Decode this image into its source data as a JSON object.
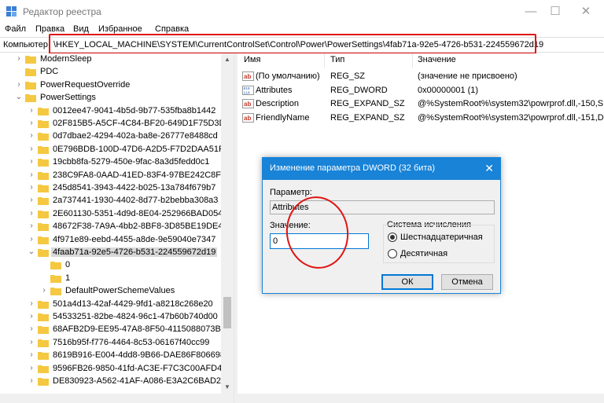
{
  "window": {
    "title": "Редактор реестра",
    "controls": {
      "minimize": "—",
      "maximize": "☐",
      "close": "✕"
    }
  },
  "menu": [
    "Файл",
    "Правка",
    "Вид",
    "Избранное",
    "Справка"
  ],
  "address": {
    "label": "Компьютер",
    "path": "\\HKEY_LOCAL_MACHINE\\SYSTEM\\CurrentControlSet\\Control\\Power\\PowerSettings\\4fab71a-92e5-4726-b531-224559672d19"
  },
  "tree": {
    "items": [
      {
        "label": "ModernSleep"
      },
      {
        "label": "PDC"
      },
      {
        "label": "PowerRequestOverride"
      },
      {
        "label": "PowerSettings"
      },
      {
        "label": "0012ee47-9041-4b5d-9b77-535fba8b1442"
      },
      {
        "label": "02F815B5-A5CF-4C84-BF20-649D1F75D3D8"
      },
      {
        "label": "0d7dbae2-4294-402a-ba8e-26777e8488cd"
      },
      {
        "label": "0E796BDB-100D-47D6-A2D5-F7D2DAA51F51"
      },
      {
        "label": "19cbb8fa-5279-450e-9fac-8a3d5fedd0c1"
      },
      {
        "label": "238C9FA8-0AAD-41ED-83F4-97BE242C8F20"
      },
      {
        "label": "245d8541-3943-4422-b025-13a784f679b7"
      },
      {
        "label": "2a737441-1930-4402-8d77-b2bebba308a3"
      },
      {
        "label": "2E601130-5351-4d9d-8E04-252966BAD054"
      },
      {
        "label": "48672F38-7A9A-4bb2-8BF8-3D85BE19DE4E"
      },
      {
        "label": "4f971e89-eebd-4455-a8de-9e59040e7347"
      },
      {
        "label": "4faab71a-92e5-4726-b531-224559672d19"
      },
      {
        "label": "0"
      },
      {
        "label": "1"
      },
      {
        "label": "DefaultPowerSchemeValues"
      },
      {
        "label": "501a4d13-42af-4429-9fd1-a8218c268e20"
      },
      {
        "label": "54533251-82be-4824-96c1-47b60b740d00"
      },
      {
        "label": "68AFB2D9-EE95-47A8-8F50-4115088073B1"
      },
      {
        "label": "7516b95f-f776-4464-8c53-06167f40cc99"
      },
      {
        "label": "8619B916-E004-4dd8-9B66-DAE86F806698"
      },
      {
        "label": "9596FB26-9850-41fd-AC3E-F7C3C00AFD4B"
      },
      {
        "label": "DE830923-A562-41AF-A086-E3A2C6BAD2DA"
      }
    ]
  },
  "values_table": {
    "headers": {
      "name": "Имя",
      "type": "Тип",
      "value": "Значение"
    },
    "rows": [
      {
        "name": "(По умолчанию)",
        "type": "REG_SZ",
        "value": "(значение не присвоено)",
        "icon": "string-value-icon"
      },
      {
        "name": "Attributes",
        "type": "REG_DWORD",
        "value": "0x00000001 (1)",
        "icon": "binary-value-icon"
      },
      {
        "name": "Description",
        "type": "REG_EXPAND_SZ",
        "value": "@%SystemRoot%\\system32\\powrprof.dll,-150,S",
        "icon": "string-value-icon"
      },
      {
        "name": "FriendlyName",
        "type": "REG_EXPAND_SZ",
        "value": "@%SystemRoot%\\system32\\powrprof.dll,-151,D",
        "icon": "string-value-icon"
      }
    ]
  },
  "dialog": {
    "title": "Изменение параметра DWORD (32 бита)",
    "close": "✕",
    "param_label": "Параметр:",
    "param_value": "Attributes",
    "value_label": "Значение:",
    "value": "0",
    "base_label": "Система исчисления",
    "hex_label": "Шестнадцатеричная",
    "dec_label": "Десятичная",
    "ok": "ОК",
    "cancel": "Отмена"
  },
  "colors": {
    "accent": "#1883d7",
    "highlight": "#e01414",
    "folder": "#f5c842"
  }
}
